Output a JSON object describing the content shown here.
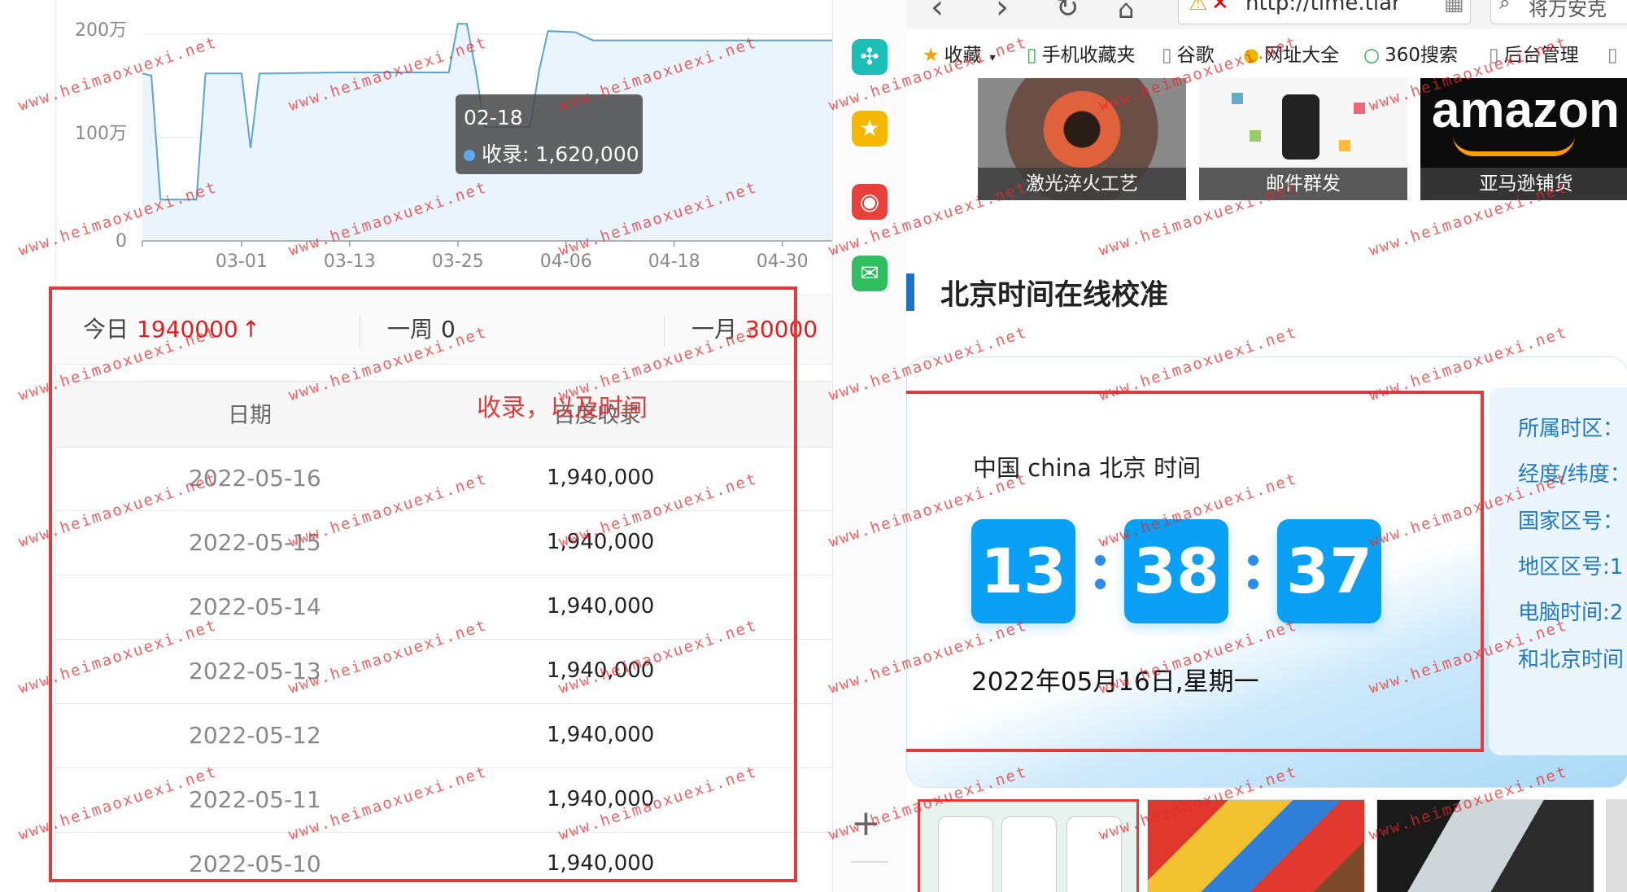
{
  "chart": {
    "y_ticks": [
      "200万",
      "100万",
      "0"
    ],
    "x_ticks": [
      "03-01",
      "03-13",
      "03-25",
      "04-06",
      "04-18",
      "04-30"
    ],
    "tooltip": {
      "date": "02-18",
      "series": "收录",
      "value": "1,620,000"
    }
  },
  "chart_data": {
    "type": "area",
    "series": [
      {
        "name": "收录",
        "x": [
          "02-18",
          "02-19",
          "02-20",
          "02-24",
          "02-25",
          "02-28",
          "03-01",
          "03-02",
          "03-03",
          "03-04",
          "03-12",
          "03-24",
          "03-25",
          "03-26",
          "03-27",
          "03-28",
          "04-02",
          "04-03",
          "04-04",
          "04-07",
          "04-09",
          "04-17",
          "05-16"
        ],
        "values": [
          1620000,
          1600000,
          400000,
          400000,
          1620000,
          1620000,
          1620000,
          900000,
          1620000,
          1620000,
          1630000,
          1630000,
          2100000,
          2100000,
          1640000,
          1100000,
          1100000,
          1640000,
          2030000,
          2020000,
          1940000,
          1940000,
          1940000
        ]
      }
    ],
    "ylim": [
      0,
      2000000
    ],
    "grid": true
  },
  "stats": {
    "today_label": "今日",
    "today_value": "1940000",
    "today_trend": "↑",
    "week_label": "一周",
    "week_value": "0",
    "month_label": "一月",
    "month_value": "30000"
  },
  "table": {
    "headers": [
      "日期",
      "百度收录"
    ],
    "rows": [
      [
        "2022-05-16",
        "1,940,000"
      ],
      [
        "2022-05-15",
        "1,940,000"
      ],
      [
        "2022-05-14",
        "1,940,000"
      ],
      [
        "2022-05-13",
        "1,940,000"
      ],
      [
        "2022-05-12",
        "1,940,000"
      ],
      [
        "2022-05-11",
        "1,940,000"
      ],
      [
        "2022-05-10",
        "1,940,000"
      ]
    ]
  },
  "annotation_text": "收录，以及时间",
  "browser": {
    "url": "http://time.tiar",
    "search_placeholder": "将万安克",
    "bookmarks": [
      "收藏",
      "手机收藏夹",
      "谷歌",
      "网址大全",
      "360搜索",
      "后台管理"
    ]
  },
  "thumbnails": [
    "激光淬火工艺",
    "邮件群发",
    "亚马逊铺货"
  ],
  "amazon_logo_text": "amazon",
  "clock": {
    "section_title": "北京时间在线校准",
    "location": "中国 china 北京 时间",
    "hours": "13",
    "minutes": "38",
    "seconds": "37",
    "date": "2022年05月16日,星期一"
  },
  "info": [
    "所属时区：",
    "经度/纬度：",
    "国家区号：",
    "地区区号:1",
    "电脑时间:2",
    "和北京时间"
  ],
  "watermark": "www.heimaoxuexi.net",
  "colors": {
    "accent_red": "#e02020",
    "clock_blue": "#0aa0f5",
    "series_line": "#5ba3d0",
    "annotation": "#e53a3a"
  }
}
